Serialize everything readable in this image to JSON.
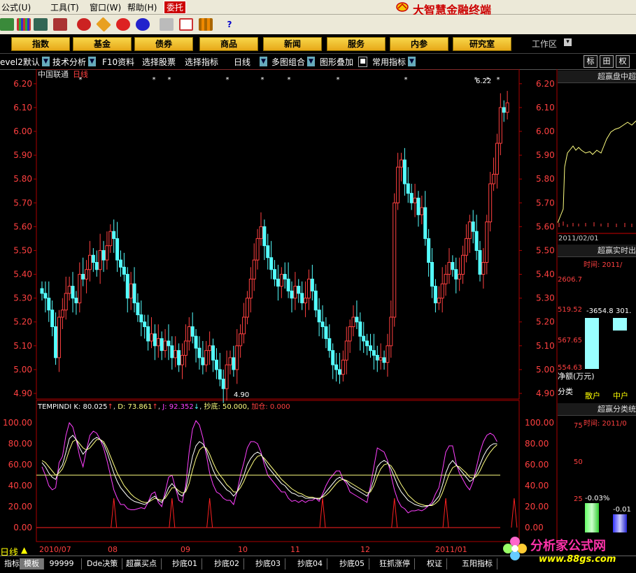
{
  "menu": {
    "items": [
      "公式(U)",
      "工具(T)",
      "窗口(W)",
      "帮助(H)"
    ],
    "trade": "委托",
    "app_title": "大智慧金融终端"
  },
  "categories": [
    "指数",
    "基金",
    "债券",
    "商品",
    "新闻",
    "服务",
    "内参",
    "研究室"
  ],
  "workspace": "工作区",
  "funcbar": {
    "level2": "evel2默认",
    "tech": "技术分析",
    "f10": "F10资料",
    "select_stock": "选择股票",
    "select_indicator": "选择指标",
    "period": "日线",
    "multi": "多图组合",
    "overlay": "图形叠加",
    "common": "常用指标",
    "right_btns": [
      "标",
      "田",
      "权"
    ]
  },
  "stock": {
    "name": "中国联通",
    "period": "日线",
    "low_label": "4.90",
    "high_label": "6.22"
  },
  "price_axis": [
    "6.20",
    "6.10",
    "6.00",
    "5.90",
    "5.80",
    "5.70",
    "5.60",
    "5.50",
    "5.40",
    "5.30",
    "5.20",
    "5.10",
    "5.00",
    "4.90"
  ],
  "indicator": {
    "name": "TEMPINDI",
    "k_label": "K: 80.025",
    "d_label": "D: 73.861",
    "j_label": "J: 92.352",
    "chaodi_label": "抄底: 50.000,",
    "jiacang_label": "加仓: 0.000",
    "axis": [
      "100.00",
      "80.00",
      "60.00",
      "40.00",
      "20.00",
      "0.00"
    ]
  },
  "date_axis": [
    "2010/07",
    "08",
    "09",
    "10",
    "11",
    "12",
    "2011/01"
  ],
  "right_panels": {
    "p1_title": "超赢盘中超",
    "p1_axis": [
      "6.20",
      "6.10",
      "6.00",
      "5.90",
      "5.80",
      "5.70",
      "5.60"
    ],
    "p1_date": "2011/02/01",
    "p2_title": "超赢实时出",
    "p2_time": "时间: 2011/",
    "p2_axis": [
      "2606.7",
      "519.52",
      "567.65",
      "554.63"
    ],
    "p2_val1": "-3654.8",
    "p2_val2": "301.",
    "p2_net": "净额(万元)",
    "p2_class": "分类",
    "p2_cats": [
      "散户",
      "中户"
    ],
    "p3_title": "超赢分类统",
    "p3_time": "时间: 2011/0",
    "p3_axis": [
      "75",
      "50",
      "25"
    ],
    "p3_v1": "-0.03%",
    "p3_v2": "-0.01"
  },
  "period_label": "日线",
  "tabs": [
    "指标",
    "模板",
    "99999",
    "Dde决策",
    "超赢买点",
    "抄底01",
    "抄底02",
    "抄底03",
    "抄底04",
    "抄底05",
    "狂抓涨停",
    "权证",
    "五阳指标"
  ],
  "watermark": {
    "name": "分析家公式网",
    "url": "www.88gs.com"
  },
  "colors": {
    "up": "#ff4040",
    "down": "#54ffff",
    "k": "#ffffff",
    "d": "#ffff80",
    "j": "#ff40ff",
    "signal": "#ff2020",
    "axis_red": "#e00000"
  },
  "chart_data": {
    "type": "candlestick",
    "title": "中国联通 日线",
    "ylim": [
      4.9,
      6.22
    ],
    "x_ticks": [
      "2010/07",
      "08",
      "09",
      "10",
      "11",
      "12",
      "2011/01"
    ],
    "close": [
      5.32,
      5.3,
      5.25,
      5.18,
      5.05,
      5.22,
      5.25,
      5.32,
      5.35,
      5.3,
      5.28,
      5.4,
      5.38,
      5.42,
      5.48,
      5.45,
      5.42,
      5.5,
      5.46,
      5.52,
      5.58,
      5.55,
      5.46,
      5.43,
      5.4,
      5.3,
      5.36,
      5.28,
      5.23,
      5.2,
      5.18,
      5.12,
      5.15,
      5.1,
      5.13,
      5.08,
      5.12,
      5.1,
      5.05,
      5.08,
      5.02,
      5.06,
      5.12,
      5.18,
      5.14,
      5.09,
      5.05,
      5.02,
      5.08,
      5.1,
      5.04,
      5.0,
      4.96,
      4.92,
      5.02,
      5.05,
      5.0,
      5.1,
      5.15,
      5.22,
      5.3,
      5.38,
      5.46,
      5.55,
      5.6,
      5.52,
      5.47,
      5.42,
      5.38,
      5.35,
      5.4,
      5.38,
      5.33,
      5.3,
      5.35,
      5.32,
      5.28,
      5.3,
      5.38,
      5.33,
      5.25,
      5.2,
      5.18,
      5.13,
      5.08,
      5.02,
      5.0,
      4.98,
      5.04,
      5.12,
      5.18,
      5.22,
      5.2,
      5.14,
      5.12,
      5.1,
      5.08,
      5.06,
      5.04,
      5.05,
      5.03,
      5.1,
      5.22,
      5.7,
      5.85,
      5.88,
      5.78,
      5.74,
      5.7,
      5.72,
      5.65,
      5.68,
      5.55,
      5.45,
      5.35,
      5.28,
      5.3,
      5.36,
      5.4,
      5.45,
      5.42,
      5.38,
      5.4,
      5.48,
      5.55,
      5.62,
      5.58,
      5.5,
      5.4,
      5.45,
      5.62,
      5.78,
      5.82,
      5.95,
      6.1,
      6.08,
      6.12
    ],
    "k": [
      62,
      58,
      52,
      48,
      46,
      55,
      60,
      72,
      85,
      88,
      84,
      76,
      70,
      74,
      80,
      84,
      86,
      84,
      80,
      72,
      62,
      52,
      44,
      38,
      34,
      30,
      27,
      25,
      24,
      23,
      22,
      24,
      28,
      30,
      26,
      24,
      30,
      38,
      42,
      38,
      32,
      30,
      36,
      52,
      68,
      78,
      82,
      80,
      74,
      64,
      55,
      48,
      44,
      40,
      36,
      34,
      30,
      34,
      42,
      50,
      60,
      66,
      70,
      72,
      70,
      64,
      58,
      54,
      50,
      46,
      42,
      40,
      36,
      33,
      32,
      30,
      30,
      28,
      28,
      28,
      28,
      27,
      30,
      34,
      38,
      42,
      46,
      48,
      46,
      44,
      40,
      38,
      36,
      34,
      32,
      30,
      36,
      46,
      58,
      62,
      64,
      62,
      56,
      48,
      40,
      34,
      30,
      26,
      24,
      22,
      21,
      20,
      20,
      21,
      22,
      26,
      30,
      40,
      52,
      60,
      64,
      60,
      56,
      52,
      48,
      44,
      46,
      52,
      60,
      68,
      74,
      78,
      80,
      80
    ],
    "d": [
      64,
      62,
      58,
      54,
      50,
      52,
      56,
      64,
      74,
      82,
      84,
      80,
      76,
      74,
      76,
      80,
      84,
      84,
      82,
      76,
      68,
      60,
      52,
      46,
      40,
      36,
      32,
      29,
      27,
      25,
      24,
      24,
      26,
      28,
      27,
      26,
      28,
      33,
      38,
      38,
      35,
      33,
      34,
      42,
      55,
      66,
      74,
      77,
      76,
      70,
      62,
      55,
      50,
      46,
      41,
      38,
      34,
      34,
      38,
      44,
      52,
      58,
      64,
      68,
      69,
      66,
      62,
      58,
      54,
      50,
      46,
      43,
      40,
      37,
      35,
      33,
      32,
      30,
      29,
      29,
      28,
      28,
      29,
      31,
      34,
      38,
      42,
      45,
      46,
      45,
      43,
      41,
      39,
      37,
      35,
      33,
      34,
      40,
      49,
      56,
      60,
      61,
      59,
      54,
      47,
      41,
      36,
      31,
      28,
      25,
      23,
      22,
      21,
      21,
      21,
      23,
      26,
      33,
      42,
      51,
      57,
      59,
      58,
      55,
      52,
      48,
      47,
      49,
      54,
      61,
      67,
      72,
      76,
      79
    ],
    "j": [
      58,
      50,
      40,
      36,
      38,
      62,
      68,
      88,
      100,
      96,
      84,
      68,
      58,
      74,
      88,
      92,
      90,
      84,
      76,
      64,
      50,
      36,
      28,
      22,
      22,
      18,
      17,
      17,
      18,
      19,
      18,
      24,
      32,
      34,
      24,
      20,
      34,
      48,
      50,
      38,
      26,
      24,
      40,
      72,
      94,
      102,
      98,
      86,
      70,
      52,
      41,
      34,
      32,
      28,
      26,
      26,
      22,
      34,
      50,
      62,
      76,
      82,
      82,
      80,
      72,
      60,
      50,
      46,
      42,
      38,
      34,
      34,
      28,
      25,
      26,
      24,
      26,
      24,
      26,
      26,
      28,
      25,
      32,
      40,
      46,
      50,
      54,
      54,
      46,
      42,
      34,
      32,
      30,
      28,
      26,
      24,
      40,
      58,
      76,
      74,
      72,
      64,
      50,
      36,
      26,
      20,
      18,
      14,
      16,
      16,
      17,
      16,
      18,
      21,
      24,
      32,
      38,
      54,
      72,
      78,
      78,
      62,
      52,
      46,
      40,
      36,
      44,
      58,
      72,
      82,
      88,
      90,
      88,
      82
    ],
    "chaodi": [
      50
    ],
    "jiacang_spikes": [
      21,
      38,
      49,
      82,
      103,
      118,
      138
    ]
  }
}
